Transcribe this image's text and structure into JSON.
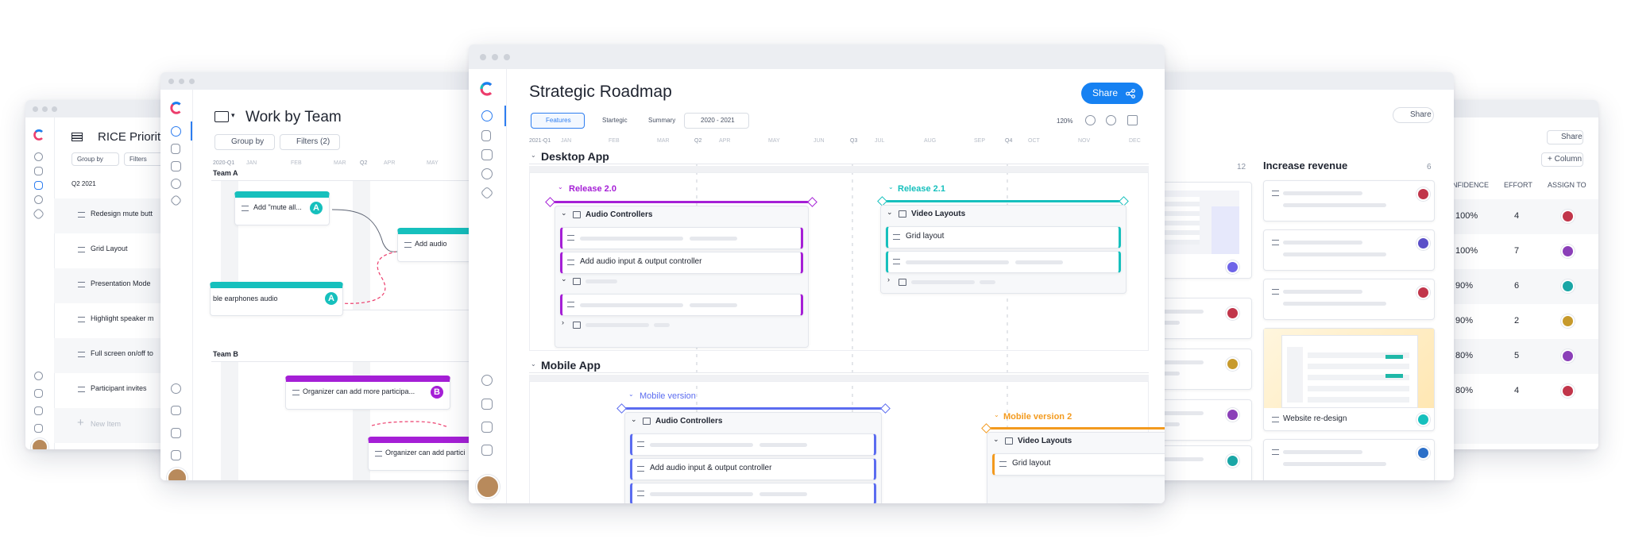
{
  "rice_window": {
    "title": "RICE Priorit",
    "group_by": "Group by",
    "filters": "Filters",
    "section": "Q2 2021",
    "rows": [
      "Redesign mute butt",
      "Grid Layout",
      "Presentation Mode",
      "Highlight speaker m",
      "Full screen on/off to",
      "Participant invites"
    ],
    "new_item": "New Item"
  },
  "team_window": {
    "title": "Work by Team",
    "group_by": "Group by",
    "filters": "Filters (2)",
    "timeline": [
      "2020-Q1",
      "JAN",
      "FEB",
      "MAR",
      "Q2",
      "APR",
      "MAY"
    ],
    "team_a": "Team A",
    "team_b": "Team B",
    "cards": {
      "mute": "Add \"mute all...",
      "audio": "Add audio",
      "earphones": "ble earphones audio",
      "organizer1": "Organizer can add more participa...",
      "organizer2": "Organizer can add partici"
    },
    "badges": {
      "a": "A",
      "b": "B"
    }
  },
  "main_window": {
    "title": "Strategic Roadmap",
    "share": "Share",
    "toolbar": {
      "features": "Features",
      "startegic": "Startegic",
      "summary": "Summary",
      "range": "2020 - 2021",
      "zoom": "120%"
    },
    "timeline": [
      "2021-Q1",
      "JAN",
      "FEB",
      "MAR",
      "Q2",
      "APR",
      "MAY",
      "JUN",
      "Q3",
      "JUL",
      "AUG",
      "SEP",
      "Q4",
      "OCT",
      "NOV",
      "DEC"
    ],
    "desktop": {
      "section": "Desktop App",
      "release1": "Release 2.0",
      "release2": "Release 2.1",
      "group1": "Audio Controllers",
      "item1": "Add audio input & output controller",
      "group2": "Video Layouts",
      "item2": "Grid layout"
    },
    "mobile": {
      "section": "Mobile App",
      "release1": "Mobile version",
      "release2": "Mobile version 2",
      "group1": "Audio Controllers",
      "item1": "Add audio input & output controller",
      "group2": "Video Layouts",
      "item2": "Grid layout"
    }
  },
  "board_window": {
    "share": "Share",
    "column_count": "12",
    "column_title": "Increase revenue",
    "column_count2": "6",
    "card_label": "Website re-design"
  },
  "table_window": {
    "share": "Share",
    "add_column": "+ Column",
    "headers": [
      "NFIDENCE",
      "EFFORT",
      "ASSIGN TO"
    ],
    "rows": [
      [
        "100%",
        "4"
      ],
      [
        "100%",
        "7"
      ],
      [
        "90%",
        "6"
      ],
      [
        "90%",
        "2"
      ],
      [
        "80%",
        "5"
      ],
      [
        "80%",
        "4"
      ]
    ]
  },
  "colors": {
    "brand_blue": "#1681f2",
    "purple": "#a51fd6",
    "teal": "#16c0bd",
    "indigo": "#5b6cf0",
    "orange": "#f39a1e",
    "pink": "#ec3d6c"
  }
}
